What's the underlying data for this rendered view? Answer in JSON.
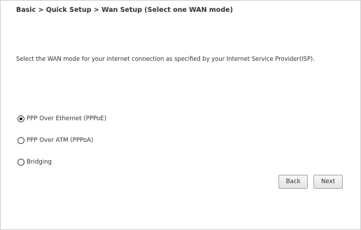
{
  "breadcrumb": "Basic > Quick Setup > Wan Setup (Select one WAN mode)",
  "intro_text": "Select the WAN mode for your internet connection as specified by your Internet Service Provider(ISP).",
  "wan_modes": [
    {
      "label": "PPP Over Ethernet (PPPoE)",
      "selected": true
    },
    {
      "label": "PPP Over ATM (PPPoA)",
      "selected": false
    },
    {
      "label": "Bridging",
      "selected": false
    }
  ],
  "buttons": {
    "back_label": "Back",
    "next_label": "Next"
  }
}
